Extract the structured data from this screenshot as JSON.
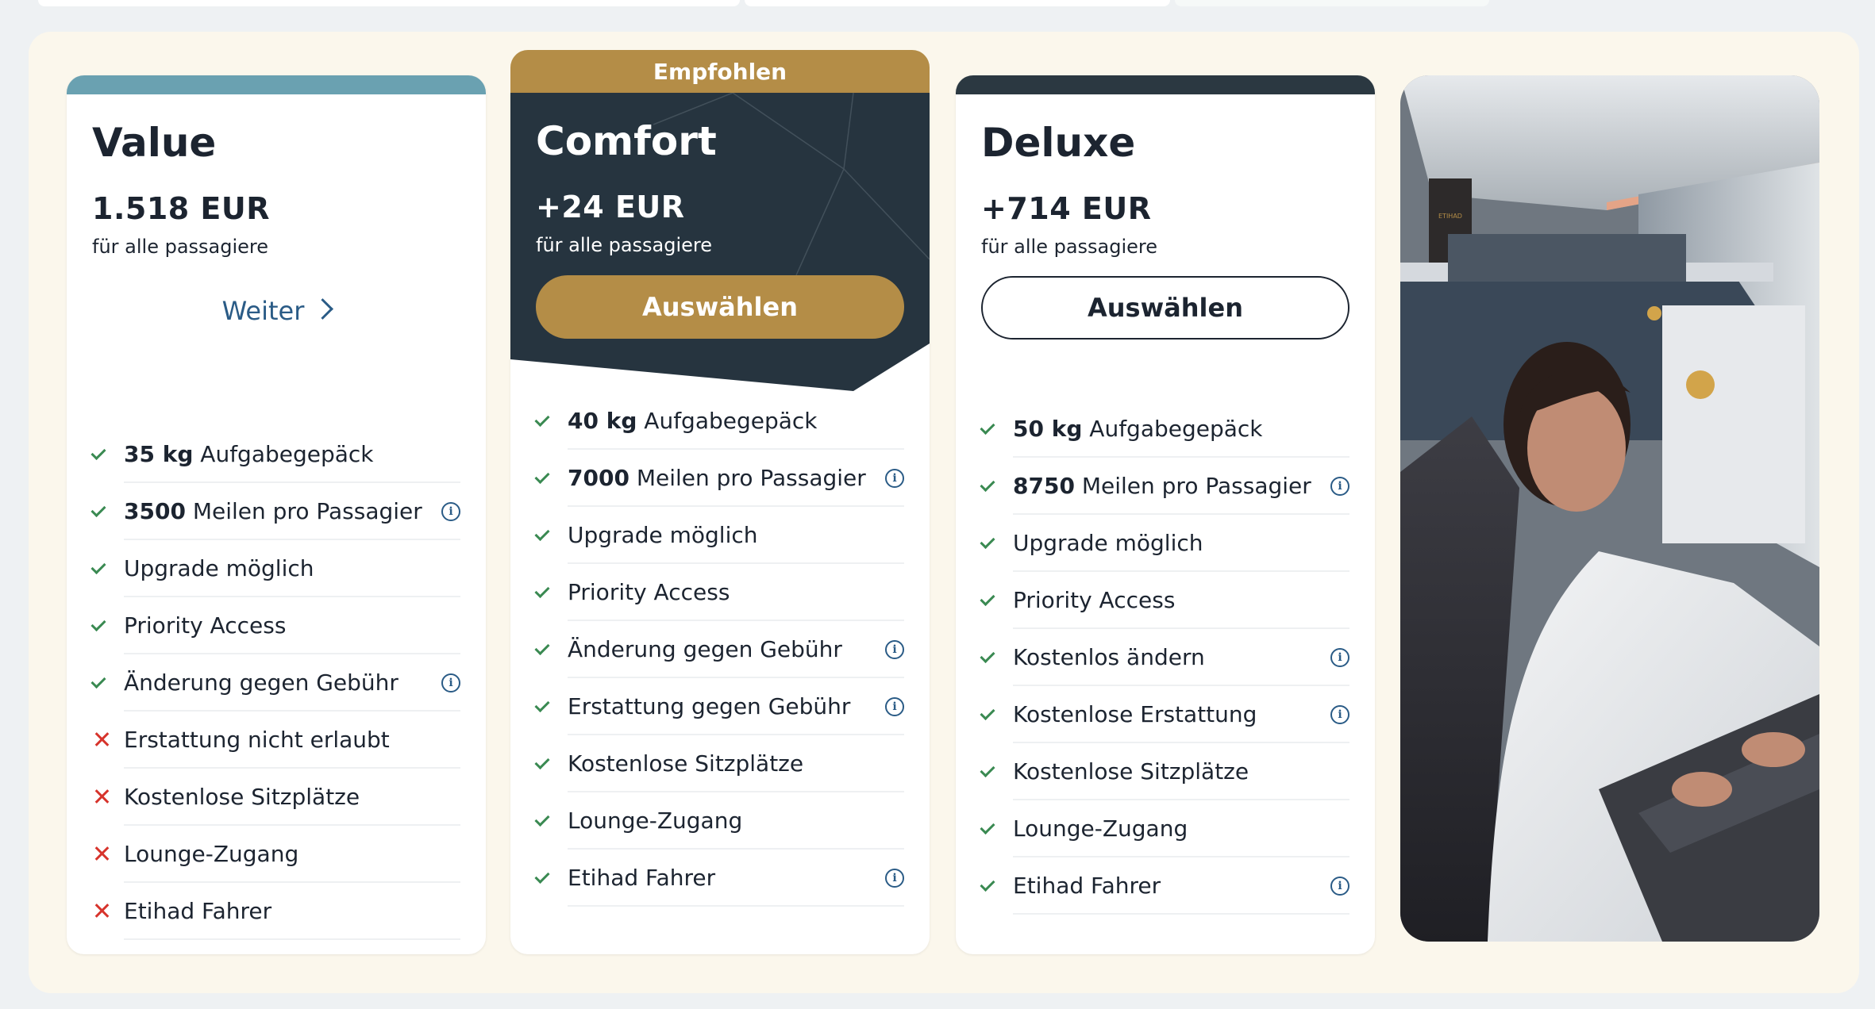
{
  "colors": {
    "value_band": "#6aa1b1",
    "comfort_gold": "#b48d47",
    "comfort_dark": "#26343f",
    "deluxe_band": "#2b3841",
    "check_green": "#3a8a52",
    "cross_red": "#d7342c",
    "link_blue": "#2a5b86",
    "panel_bg": "#fbf7ec"
  },
  "fares": {
    "value": {
      "name": "Value",
      "price": "1.518  EUR",
      "price_sub": "für alle passagiere",
      "action_label": "Weiter",
      "features": [
        {
          "bold": "35 kg",
          "text": " Aufgabegepäck",
          "status": "included",
          "info": false
        },
        {
          "bold": "3500",
          "text": " Meilen pro Passagier",
          "status": "included",
          "info": true
        },
        {
          "bold": "",
          "text": "Upgrade möglich",
          "status": "included",
          "info": false
        },
        {
          "bold": "",
          "text": "Priority Access",
          "status": "included",
          "info": false
        },
        {
          "bold": "",
          "text": "Änderung gegen Gebühr",
          "status": "included",
          "info": true
        },
        {
          "bold": "",
          "text": "Erstattung nicht erlaubt",
          "status": "excluded",
          "info": false
        },
        {
          "bold": "",
          "text": "Kostenlose Sitzplätze",
          "status": "excluded",
          "info": false
        },
        {
          "bold": "",
          "text": "Lounge-Zugang",
          "status": "excluded",
          "info": false
        },
        {
          "bold": "",
          "text": "Etihad Fahrer",
          "status": "excluded",
          "info": false
        }
      ]
    },
    "comfort": {
      "tag": "Empfohlen",
      "name": "Comfort",
      "price": "+24  EUR",
      "price_sub": "für alle passagiere",
      "action_label": "Auswählen",
      "features": [
        {
          "bold": "40 kg",
          "text": " Aufgabegepäck",
          "status": "included",
          "info": false
        },
        {
          "bold": "7000",
          "text": " Meilen pro Passagier",
          "status": "included",
          "info": true
        },
        {
          "bold": "",
          "text": "Upgrade möglich",
          "status": "included",
          "info": false
        },
        {
          "bold": "",
          "text": "Priority Access",
          "status": "included",
          "info": false
        },
        {
          "bold": "",
          "text": "Änderung gegen Gebühr",
          "status": "included",
          "info": true
        },
        {
          "bold": "",
          "text": "Erstattung gegen Gebühr",
          "status": "included",
          "info": true
        },
        {
          "bold": "",
          "text": "Kostenlose Sitzplätze",
          "status": "included",
          "info": false
        },
        {
          "bold": "",
          "text": "Lounge-Zugang",
          "status": "included",
          "info": false
        },
        {
          "bold": "",
          "text": "Etihad Fahrer",
          "status": "included",
          "info": true
        }
      ]
    },
    "deluxe": {
      "name": "Deluxe",
      "price": "+714  EUR",
      "price_sub": "für alle passagiere",
      "action_label": "Auswählen",
      "features": [
        {
          "bold": "50 kg",
          "text": " Aufgabegepäck",
          "status": "included",
          "info": false
        },
        {
          "bold": "8750",
          "text": " Meilen pro Passagier",
          "status": "included",
          "info": true
        },
        {
          "bold": "",
          "text": "Upgrade möglich",
          "status": "included",
          "info": false
        },
        {
          "bold": "",
          "text": "Priority Access",
          "status": "included",
          "info": false
        },
        {
          "bold": "",
          "text": "Kostenlos ändern",
          "status": "included",
          "info": true
        },
        {
          "bold": "",
          "text": "Kostenlose Erstattung",
          "status": "included",
          "info": true
        },
        {
          "bold": "",
          "text": "Kostenlose Sitzplätze",
          "status": "included",
          "info": false
        },
        {
          "bold": "",
          "text": "Lounge-Zugang",
          "status": "included",
          "info": false
        },
        {
          "bold": "",
          "text": "Etihad Fahrer",
          "status": "included",
          "info": true
        }
      ]
    }
  },
  "icons": {
    "included": "check-icon",
    "excluded": "cross-icon",
    "info": "info-icon",
    "chevron": "chevron-right-icon"
  },
  "photo": {
    "subject": "business-class-cabin-passenger-photo",
    "logo_text": "ETIHAD"
  }
}
